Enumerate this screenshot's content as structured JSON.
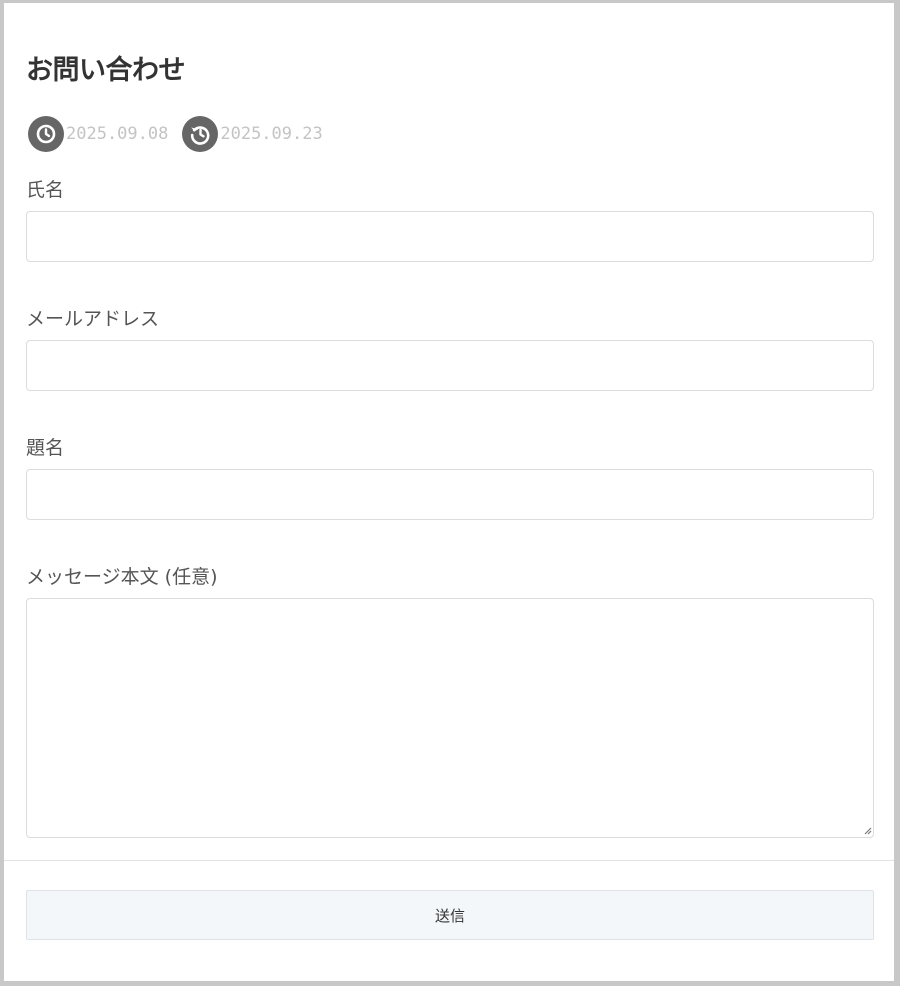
{
  "page": {
    "title": "お問い合わせ"
  },
  "meta": {
    "published_date": "2025.09.08",
    "published_icon": "clock-icon",
    "updated_date": "2025.09.23",
    "updated_icon": "history-icon"
  },
  "form": {
    "name": {
      "label": "氏名",
      "value": "",
      "placeholder": ""
    },
    "email": {
      "label": "メールアドレス",
      "value": "",
      "placeholder": ""
    },
    "subject": {
      "label": "題名",
      "value": "",
      "placeholder": ""
    },
    "message": {
      "label": "メッセージ本文 (任意)",
      "value": "",
      "placeholder": ""
    },
    "submit_label": "送信"
  },
  "colors": {
    "page_background": "#ffffff",
    "frame": "#c8c8c8",
    "title_text": "#333333",
    "label_text": "#555555",
    "date_text": "#c4c4c4",
    "icon_circle": "#666666",
    "input_border": "#dcdcdc",
    "button_background": "#f4f7fa"
  }
}
